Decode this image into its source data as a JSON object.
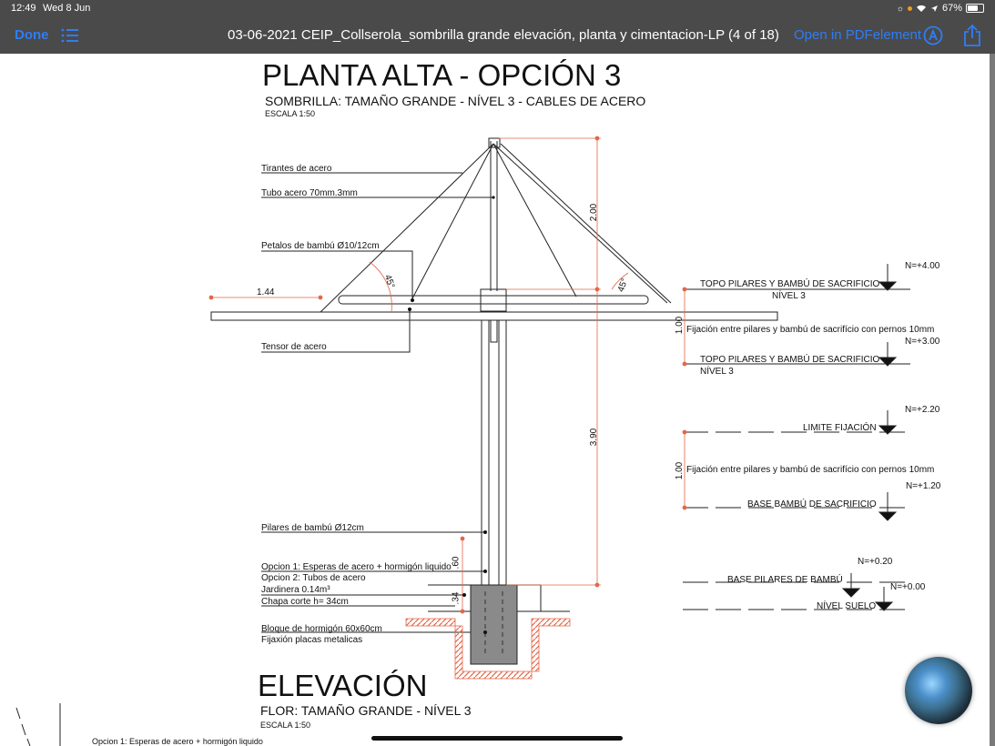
{
  "status": {
    "time": "12:49",
    "date": "Wed 8 Jun",
    "battery": "67%",
    "battery_level": 0.67
  },
  "nav": {
    "done_label": "Done",
    "title": "03-06-2021 CEIP_Collserola_sombrilla grande elevación, planta y cimentacion-LP (4 of 18)",
    "open_label": "Open in PDFelement"
  },
  "colors": {
    "toolbar": "#4a4a4a",
    "accent": "#2f7df6",
    "dimension": "#e2674a"
  },
  "page": {
    "title": "PLANTA ALTA - OPCIÓN 3",
    "subtitle": "SOMBRILLA: TAMAÑO GRANDE - NÍVEL 3 - CABLES DE ACERO",
    "scale": "ESCALA 1:50",
    "labels": {
      "tirantes": "Tirantes de acero",
      "tubo": "Tubo acero 70mm.3mm",
      "petalos": "Petalos de bambú Ø10/12cm",
      "tensor": "Tensor de acero",
      "pilares": "Pilares de bambú Ø12cm",
      "opcion1": "Opcion 1: Esperas de acero + hormigón liquido",
      "opcion2": "Opcion 2: Tubos de acero",
      "jardinera": "Jardinera 0.14m³",
      "chapa": "Chapa corte h= 34cm",
      "bloque": "Bloque de hormigón 60x60cm",
      "fijacion_placas": "Fijaxión placas metalicas"
    },
    "dims": {
      "d144": "1.44",
      "d200": "2.00",
      "d390": "3.90",
      "d60": ".60",
      "d34": ".34",
      "d100a": "1.00",
      "d100b": "1.00",
      "ang1": "45°",
      "ang2": "45°"
    },
    "levels": {
      "n400": "N=+4.00",
      "topo1": "TOPO PILARES Y BAMBÚ DE SACRIFICIO",
      "topo1_sub": "NÍVEL 3",
      "fij1": "Fijación entre pilares y bambú de sacrifício con pernos 10mm",
      "n300": "N=+3.00",
      "topo2": "TOPO PILARES Y BAMBÚ DE SACRIFICIO",
      "topo2_sub": "NÍVEL 3",
      "n220": "N=+2.20",
      "limite": "LIMITE FIJACIÓN",
      "fij2": "Fijación entre pilares y bambú de sacrifício con pernos 10mm",
      "n120": "N=+1.20",
      "base_bambu": "BASE BAMBÚ DE SACRIFICIO",
      "n020": "N=+0.20",
      "base_pilares": "BASE PILARES DE BAMBÚ",
      "n000": "N=+0.00",
      "suelo": "NÍVEL SUELO"
    },
    "elev_title": "ELEVACIÓN",
    "elev_subtitle": "FLOR: TAMAÑO GRANDE - NÍVEL 3",
    "elev_scale": "ESCALA 1:50",
    "bottom_label": "Opcion 1: Esperas de acero + hormigón liquido"
  }
}
